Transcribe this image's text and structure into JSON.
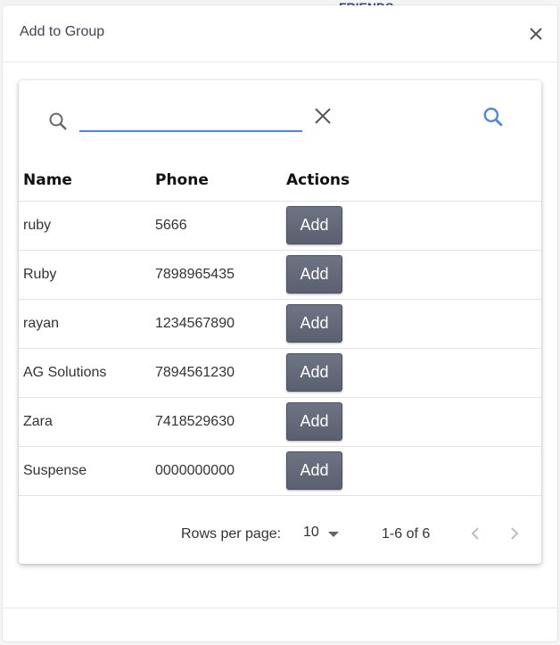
{
  "background": {
    "logo_text": "FRIENDS"
  },
  "dialog": {
    "title": "Add to Group",
    "close_icon": "close-icon"
  },
  "search": {
    "value": "",
    "placeholder": "",
    "left_icon": "search-icon",
    "clear_icon": "clear-icon",
    "submit_icon": "search-icon",
    "accent_color": "#4a86e8"
  },
  "table": {
    "columns": [
      "Name",
      "Phone",
      "Actions"
    ],
    "rows": [
      {
        "name": "ruby",
        "phone": "5666",
        "action": "Add"
      },
      {
        "name": "Ruby",
        "phone": "7898965435",
        "action": "Add"
      },
      {
        "name": "rayan",
        "phone": "1234567890",
        "action": "Add"
      },
      {
        "name": "AG Solutions",
        "phone": "7894561230",
        "action": "Add"
      },
      {
        "name": "Zara",
        "phone": "7418529630",
        "action": "Add"
      },
      {
        "name": "Suspense",
        "phone": "0000000000",
        "action": "Add"
      }
    ]
  },
  "pagination": {
    "rows_per_page_label": "Rows per page:",
    "rows_per_page_value": "10",
    "range": "1-6 of 6"
  }
}
